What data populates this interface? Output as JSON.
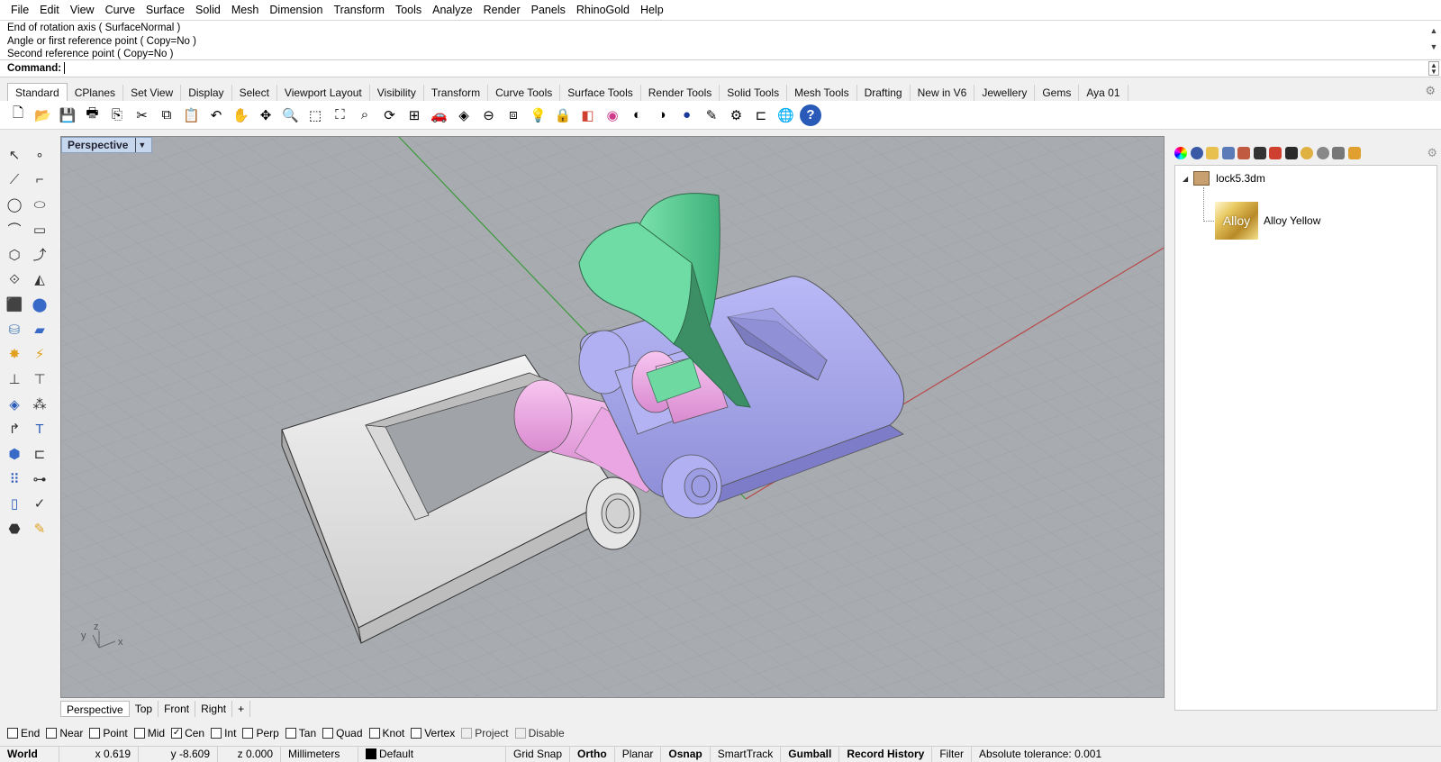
{
  "menu": [
    "File",
    "Edit",
    "View",
    "Curve",
    "Surface",
    "Solid",
    "Mesh",
    "Dimension",
    "Transform",
    "Tools",
    "Analyze",
    "Render",
    "Panels",
    "RhinoGold",
    "Help"
  ],
  "command": {
    "history": [
      "End of rotation axis ( SurfaceNormal )",
      "Angle or first reference point ( Copy=No )",
      "Second reference point ( Copy=No )"
    ],
    "label": "Command:"
  },
  "toolbar_tabs": [
    "Standard",
    "CPlanes",
    "Set View",
    "Display",
    "Select",
    "Viewport Layout",
    "Visibility",
    "Transform",
    "Curve Tools",
    "Surface Tools",
    "Render Tools",
    "Solid Tools",
    "Mesh Tools",
    "Drafting",
    "New in V6",
    "Jewellery",
    "Gems",
    "Aya 01"
  ],
  "toolbar_icons": [
    "new-file",
    "open-file",
    "save",
    "print",
    "import",
    "cut",
    "copy",
    "paste",
    "undo",
    "pan",
    "rotate-view",
    "zoom",
    "zoom-window",
    "zoom-extents",
    "zoom-selected",
    "rotate-camera",
    "four-viewports",
    "car",
    "render-preview",
    "snap",
    "named-views",
    "light-bulb",
    "lock",
    "layers",
    "color-wheel",
    "shade",
    "ghosted",
    "rendered",
    "pen",
    "settings",
    "dimension",
    "globe",
    "help"
  ],
  "left_tools": [
    "pointer",
    "point",
    "line",
    "polyline",
    "circle",
    "ellipse",
    "arc",
    "rectangle",
    "polygon",
    "curve-fillet",
    "transform",
    "surface-edit",
    "box",
    "sphere",
    "cylinder",
    "surface",
    "explode",
    "boolean",
    "mirror",
    "trim",
    "group",
    "array",
    "fillet",
    "text",
    "solid",
    "dimension",
    "grid-array",
    "analyze",
    "model",
    "check",
    "render",
    "paint"
  ],
  "viewport": {
    "title": "Perspective",
    "axis_y": "y",
    "axis_z": "z",
    "axis_x": "x"
  },
  "viewport_tabs": [
    "Perspective",
    "Top",
    "Front",
    "Right"
  ],
  "viewport_tab_add": "+",
  "panel": {
    "file_name": "lock5.3dm",
    "material_name": "Alloy Yellow",
    "thumb_text": "Alloy"
  },
  "osnaps": [
    {
      "label": "End",
      "checked": false
    },
    {
      "label": "Near",
      "checked": false
    },
    {
      "label": "Point",
      "checked": false
    },
    {
      "label": "Mid",
      "checked": false
    },
    {
      "label": "Cen",
      "checked": true
    },
    {
      "label": "Int",
      "checked": false
    },
    {
      "label": "Perp",
      "checked": false
    },
    {
      "label": "Tan",
      "checked": false
    },
    {
      "label": "Quad",
      "checked": false
    },
    {
      "label": "Knot",
      "checked": false
    },
    {
      "label": "Vertex",
      "checked": false
    }
  ],
  "osnap_extra": [
    "Project",
    "Disable"
  ],
  "status": {
    "cplane": "World",
    "x": "x 0.619",
    "y": "y -8.609",
    "z": "z 0.000",
    "units": "Millimeters",
    "layer": "Default",
    "grid_snap": "Grid Snap",
    "ortho": "Ortho",
    "planar": "Planar",
    "osnap": "Osnap",
    "smarttrack": "SmartTrack",
    "gumball": "Gumball",
    "record_history": "Record History",
    "filter": "Filter",
    "tolerance": "Absolute tolerance: 0.001"
  },
  "colors": {
    "viewport_bg": "#a8abb0",
    "x_axis": "#b8484a",
    "y_axis": "#3a9a3a",
    "part_white": "#e6e6e6",
    "part_lavender": "#aaaaf0",
    "part_pink": "#f0a8e8",
    "part_green": "#5ed69a"
  }
}
